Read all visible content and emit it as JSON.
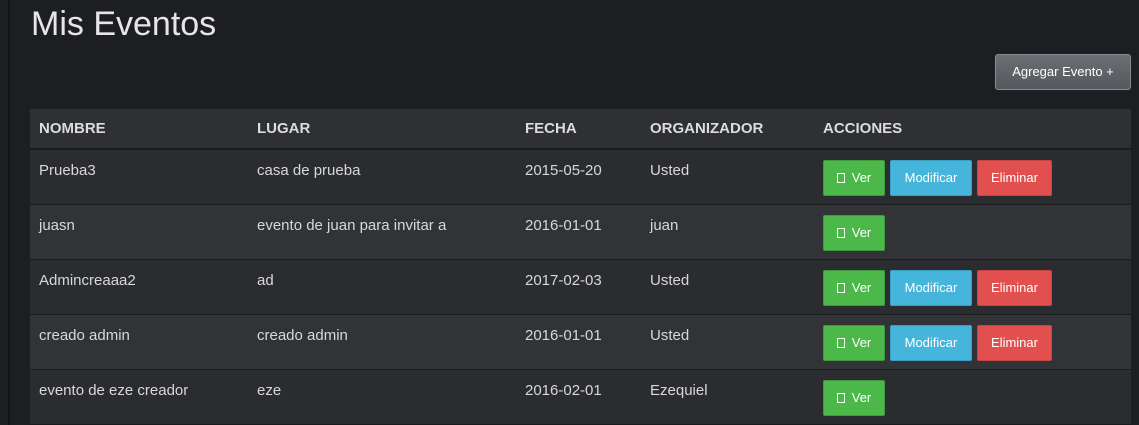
{
  "page": {
    "title": "Mis Eventos",
    "add_button_label": "Agregar Evento +"
  },
  "table": {
    "headers": [
      "NOMBRE",
      "LUGAR",
      "FECHA",
      "ORGANIZADOR",
      "ACCIONES"
    ],
    "actions": {
      "view": "Ver",
      "edit": "Modificar",
      "delete": "Eliminar"
    },
    "rows": [
      {
        "nombre": "Prueba3",
        "lugar": "casa de prueba",
        "fecha": "2015-05-20",
        "organizador": "Usted",
        "owner": true
      },
      {
        "nombre": "juasn",
        "lugar": "evento de juan para invitar a",
        "fecha": "2016-01-01",
        "organizador": "juan",
        "owner": false
      },
      {
        "nombre": "Admincreaaa2",
        "lugar": "ad",
        "fecha": "2017-02-03",
        "organizador": "Usted",
        "owner": true
      },
      {
        "nombre": "creado admin",
        "lugar": "creado admin",
        "fecha": "2016-01-01",
        "organizador": "Usted",
        "owner": true
      },
      {
        "nombre": "evento de eze creador",
        "lugar": "eze",
        "fecha": "2016-02-01",
        "organizador": "Ezequiel",
        "owner": false
      }
    ]
  },
  "colors": {
    "background": "#1d1e22",
    "ver": "#4cb84a",
    "modificar": "#45b5dc",
    "eliminar": "#e1504e"
  }
}
